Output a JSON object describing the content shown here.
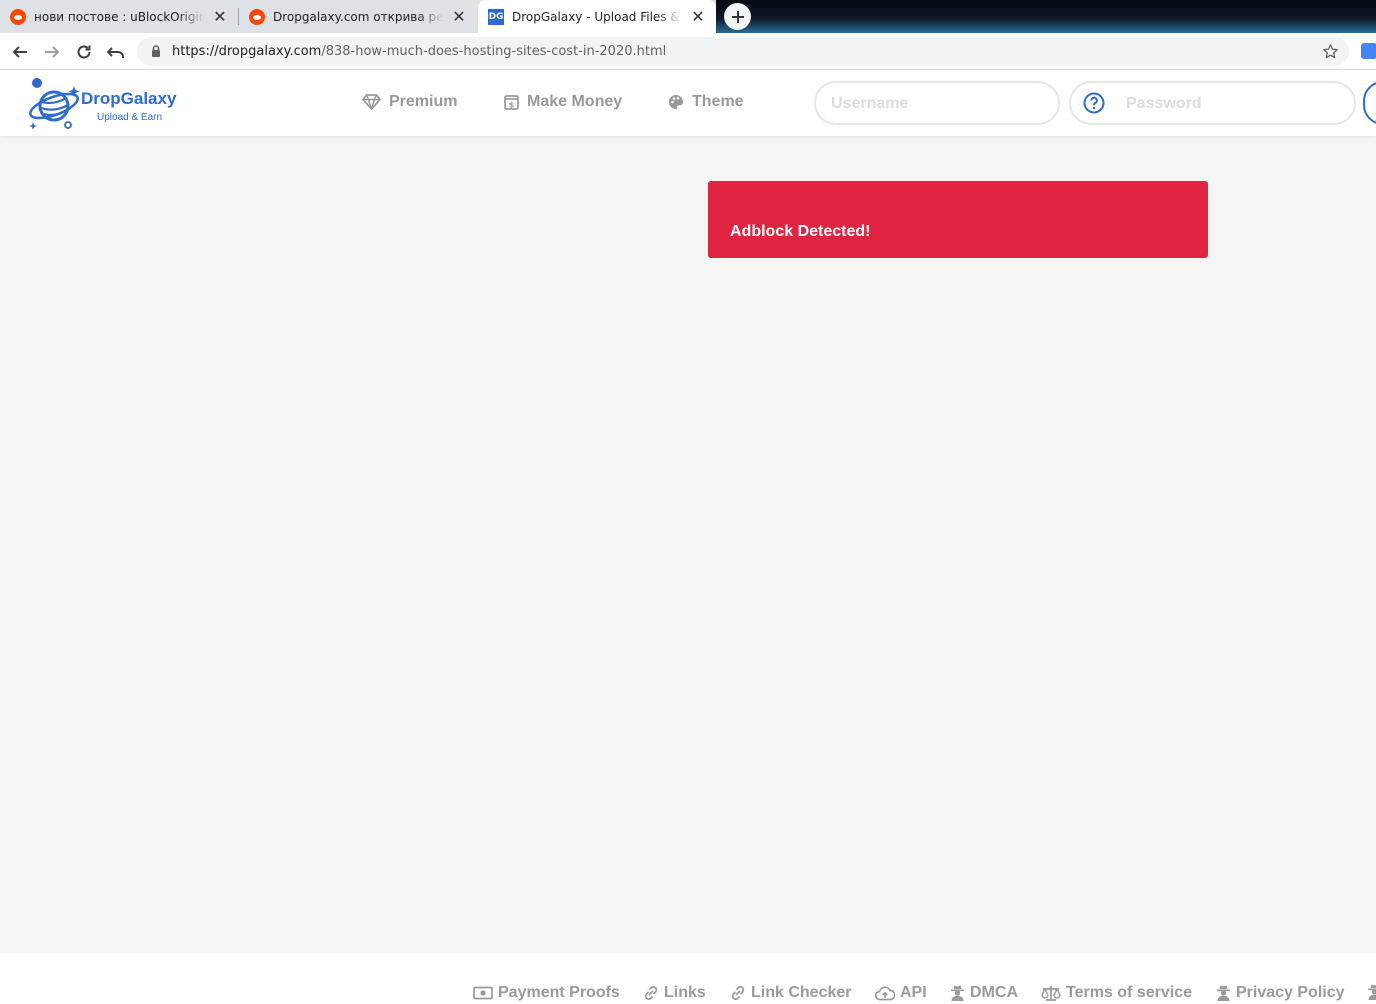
{
  "browser": {
    "tabs": [
      {
        "title": "нови постове : uBlockOrigin",
        "favicon": "reddit-icon",
        "active": false
      },
      {
        "title": "Dropgalaxy.com открива реклам",
        "favicon": "reddit-icon",
        "active": false
      },
      {
        "title": "DropGalaxy - Upload Files & Earn",
        "favicon": "dropgalaxy-icon",
        "active": true
      }
    ],
    "tab_favicon_text": "DG",
    "url_host": "https://dropgalaxy.com",
    "url_path": "/838-how-much-does-hosting-sites-cost-in-2020.html"
  },
  "header": {
    "brand": "DropGalaxy",
    "tagline": "Upload & Earn",
    "nav": [
      {
        "label": "Premium",
        "icon": "gem-icon"
      },
      {
        "label": "Make Money",
        "icon": "money-icon"
      },
      {
        "label": "Theme",
        "icon": "palette-icon"
      }
    ],
    "username_placeholder": "Username",
    "password_placeholder": "Password"
  },
  "alert": {
    "text": "Adblock Detected!",
    "color": "#e02340"
  },
  "footer": {
    "links": [
      {
        "label": "Payment Proofs",
        "icon": "money-bill-icon"
      },
      {
        "label": "Links",
        "icon": "link-icon"
      },
      {
        "label": "Link Checker",
        "icon": "link-icon"
      },
      {
        "label": "API",
        "icon": "cloud-upload-icon"
      },
      {
        "label": "DMCA",
        "icon": "user-secret-icon"
      },
      {
        "label": "Terms of service",
        "icon": "balance-scale-icon"
      },
      {
        "label": "Privacy Policy",
        "icon": "user-secret-icon"
      }
    ]
  },
  "colors": {
    "brand": "#2e6bd0",
    "nav_text": "#999999",
    "page_bg": "#f5f5f5"
  }
}
